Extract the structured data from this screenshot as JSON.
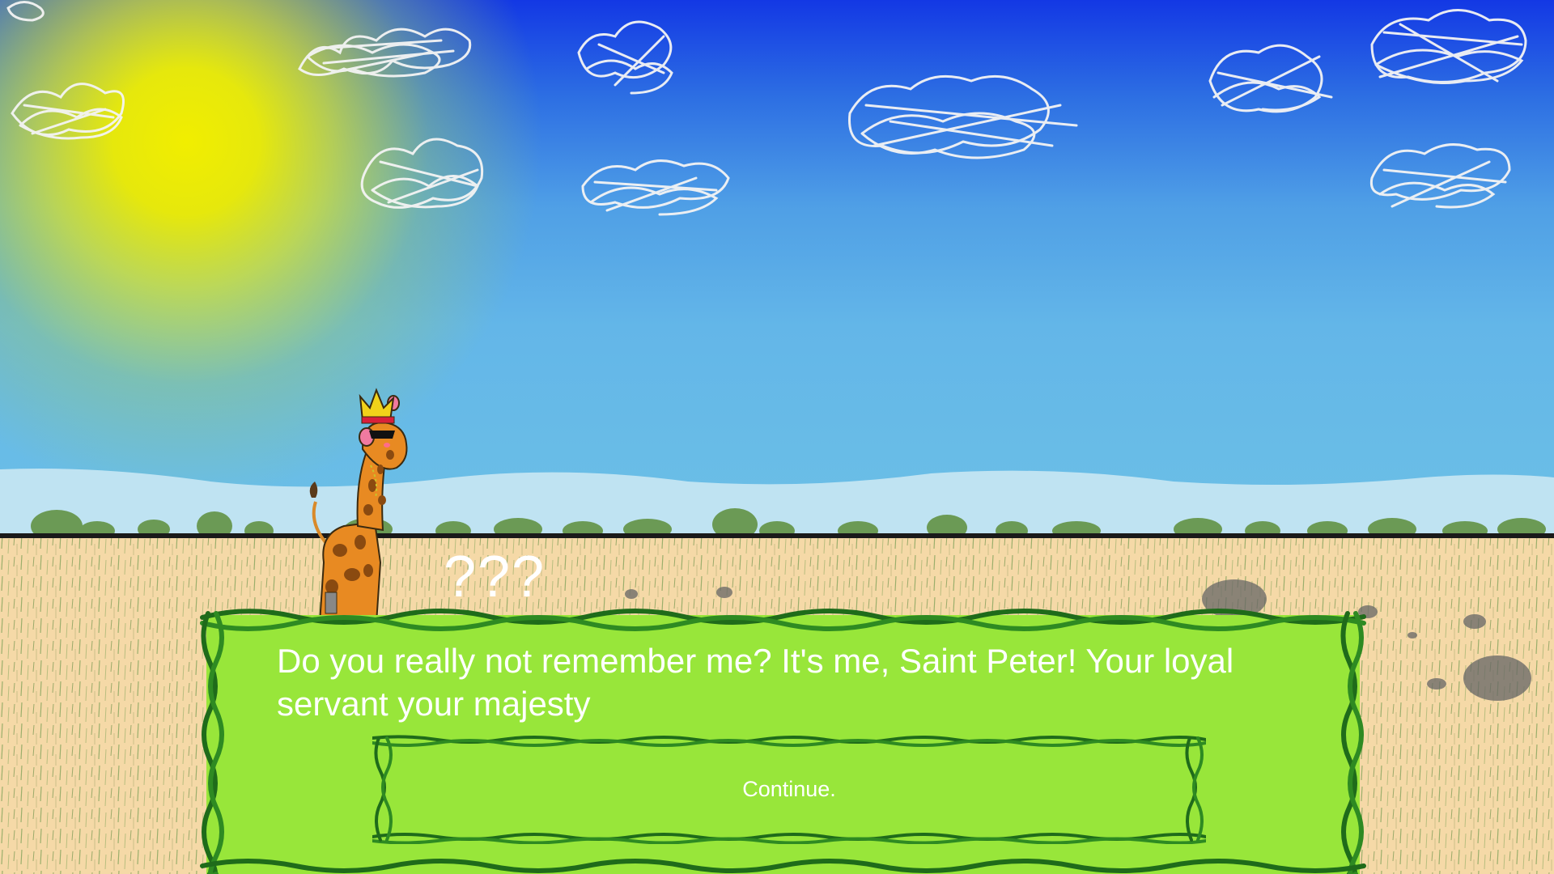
{
  "dialogue": {
    "speaker": "???",
    "text": "Do you really not remember me? It's me, Saint Peter! Your loyal servant your majesty",
    "continue_label": "Continue."
  },
  "scene": {
    "setting": "savanna",
    "character": "giraffe-with-crown"
  },
  "colors": {
    "sky_top": "#1338e4",
    "sky_bottom": "#6cc0e6",
    "sun": "#f1ee00",
    "ground": "#f5d9a7",
    "dialog_fill": "#98e63a",
    "vine_border": "#1f6b1a",
    "text": "#ffffff"
  }
}
